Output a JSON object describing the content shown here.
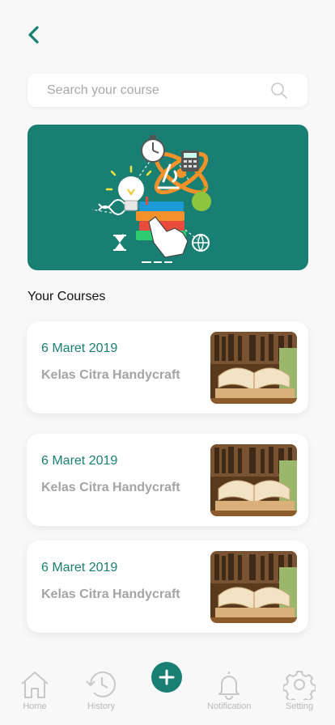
{
  "header": {
    "back_icon": "chevron-left-icon"
  },
  "search": {
    "placeholder": "Search your course",
    "icon": "search-icon"
  },
  "banner": {
    "image": "education-illustration",
    "color": "#1a7f73"
  },
  "section": {
    "title": "Your Courses"
  },
  "courses": [
    {
      "date": "6 Maret 2019",
      "name": "Kelas Citra Handycraft",
      "thumb": "open-book-image"
    },
    {
      "date": "6 Maret 2019",
      "name": "Kelas Citra Handycraft",
      "thumb": "open-book-image"
    },
    {
      "date": "6 Maret 2019",
      "name": "Kelas Citra Handycraft",
      "thumb": "open-book-image"
    }
  ],
  "nav": {
    "home": "Home",
    "history": "History",
    "add_icon": "plus-icon",
    "notification": "Notification",
    "setting": "Setting"
  },
  "colors": {
    "accent": "#1a7f73",
    "muted": "#b8b8b8"
  }
}
